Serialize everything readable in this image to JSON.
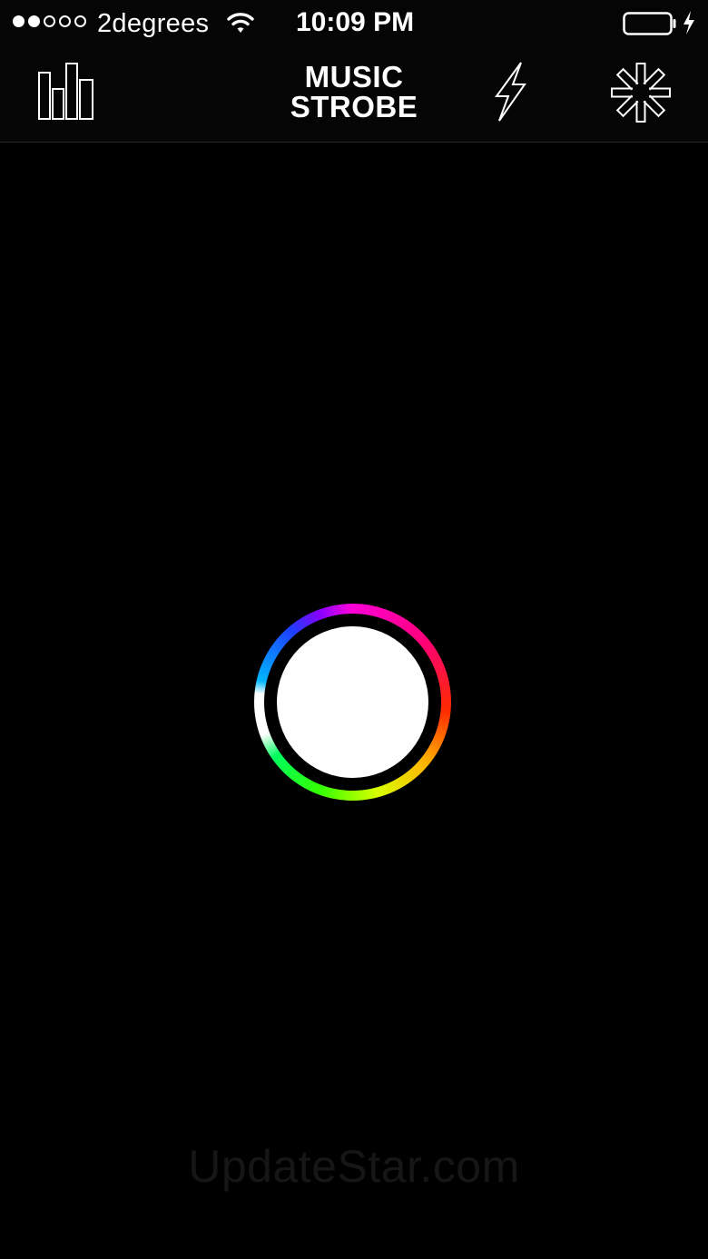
{
  "status_bar": {
    "signal": {
      "filled": 2,
      "total": 5
    },
    "carrier": "2degrees",
    "wifi_icon": "wifi-icon",
    "time": "10:09 PM",
    "battery_icon": "battery-icon",
    "charging_icon": "charging-bolt-icon"
  },
  "nav": {
    "left_icon": "equalizer-bars-icon",
    "logo_line1": "MUSIC",
    "logo_line2": "STROBE",
    "flash_icon": "lightning-bolt-icon",
    "settings_icon": "asterisk-settings-icon"
  },
  "main": {
    "strobe_button_color": "#ffffff",
    "ring_colors": [
      "#ff00d8",
      "#ff0077",
      "#ff2a00",
      "#ffb400",
      "#d8ff00",
      "#35ff00",
      "#00ff5e",
      "#ffffff",
      "#00b7ff",
      "#1f3dff",
      "#8a00ff"
    ]
  },
  "watermark": "UpdateStar.com",
  "colors": {
    "background": "#000000",
    "foreground": "#ffffff"
  }
}
